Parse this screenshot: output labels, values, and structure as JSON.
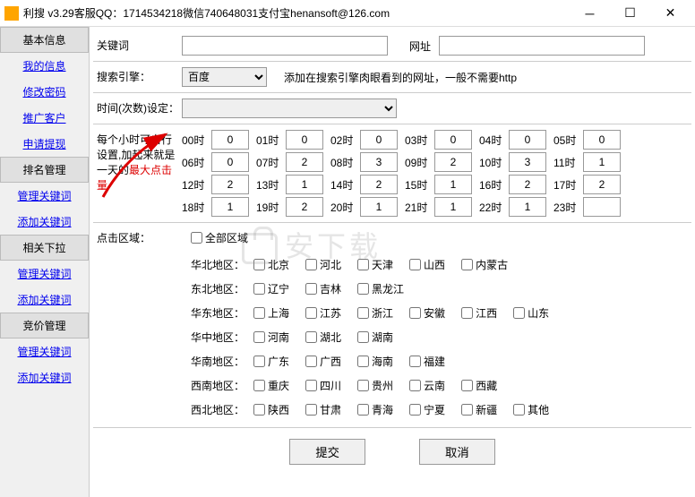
{
  "title": "利搜 v3.29客服QQ：1714534218微信740648031支付宝henansoft@126.com",
  "sidebar": {
    "groups": [
      {
        "header": "基本信息",
        "items": [
          "我的信息",
          "修改密码",
          "推广客户",
          "申请提现"
        ]
      },
      {
        "header": "排名管理",
        "items": [
          "管理关键词",
          "添加关键词"
        ]
      },
      {
        "header": "相关下拉",
        "items": [
          "管理关键词",
          "添加关键词"
        ]
      },
      {
        "header": "竞价管理",
        "items": [
          "管理关键词",
          "添加关键词"
        ]
      }
    ]
  },
  "form": {
    "keyword_label": "关键词",
    "url_label": "网址",
    "engine_label": "搜索引擎：",
    "engine_value": "百度",
    "engine_hint": "添加在搜索引擎肉眼看到的网址，一般不需要http",
    "time_label": "时间(次数)设定：",
    "hours_label_1": "每个小时可自行设置,加起来就是一天的",
    "hours_label_2": "最大点击量",
    "click_region_label": "点击区域：",
    "all_region": "全部区域",
    "hours": [
      {
        "t": "00时",
        "v": "0"
      },
      {
        "t": "01时",
        "v": "0"
      },
      {
        "t": "02时",
        "v": "0"
      },
      {
        "t": "03时",
        "v": "0"
      },
      {
        "t": "04时",
        "v": "0"
      },
      {
        "t": "05时",
        "v": "0"
      },
      {
        "t": "06时",
        "v": "0"
      },
      {
        "t": "07时",
        "v": "2"
      },
      {
        "t": "08时",
        "v": "3"
      },
      {
        "t": "09时",
        "v": "2"
      },
      {
        "t": "10时",
        "v": "3"
      },
      {
        "t": "11时",
        "v": "1"
      },
      {
        "t": "12时",
        "v": "2"
      },
      {
        "t": "13时",
        "v": "1"
      },
      {
        "t": "14时",
        "v": "2"
      },
      {
        "t": "15时",
        "v": "1"
      },
      {
        "t": "16时",
        "v": "2"
      },
      {
        "t": "17时",
        "v": "2"
      },
      {
        "t": "18时",
        "v": "1"
      },
      {
        "t": "19时",
        "v": "2"
      },
      {
        "t": "20时",
        "v": "1"
      },
      {
        "t": "21时",
        "v": "1"
      },
      {
        "t": "22时",
        "v": "1"
      },
      {
        "t": "23时",
        "v": ""
      }
    ],
    "regions": [
      {
        "label": "华北地区：",
        "items": [
          "北京",
          "河北",
          "天津",
          "山西",
          "内蒙古"
        ]
      },
      {
        "label": "东北地区：",
        "items": [
          "辽宁",
          "吉林",
          "黑龙江"
        ]
      },
      {
        "label": "华东地区：",
        "items": [
          "上海",
          "江苏",
          "浙江",
          "安徽",
          "江西",
          "山东"
        ]
      },
      {
        "label": "华中地区：",
        "items": [
          "河南",
          "湖北",
          "湖南"
        ]
      },
      {
        "label": "华南地区：",
        "items": [
          "广东",
          "广西",
          "海南",
          "福建"
        ]
      },
      {
        "label": "西南地区：",
        "items": [
          "重庆",
          "四川",
          "贵州",
          "云南",
          "西藏"
        ]
      },
      {
        "label": "西北地区：",
        "items": [
          "陕西",
          "甘肃",
          "青海",
          "宁夏",
          "新疆",
          "其他"
        ]
      }
    ],
    "submit": "提交",
    "cancel": "取消"
  },
  "watermark": "安下载"
}
